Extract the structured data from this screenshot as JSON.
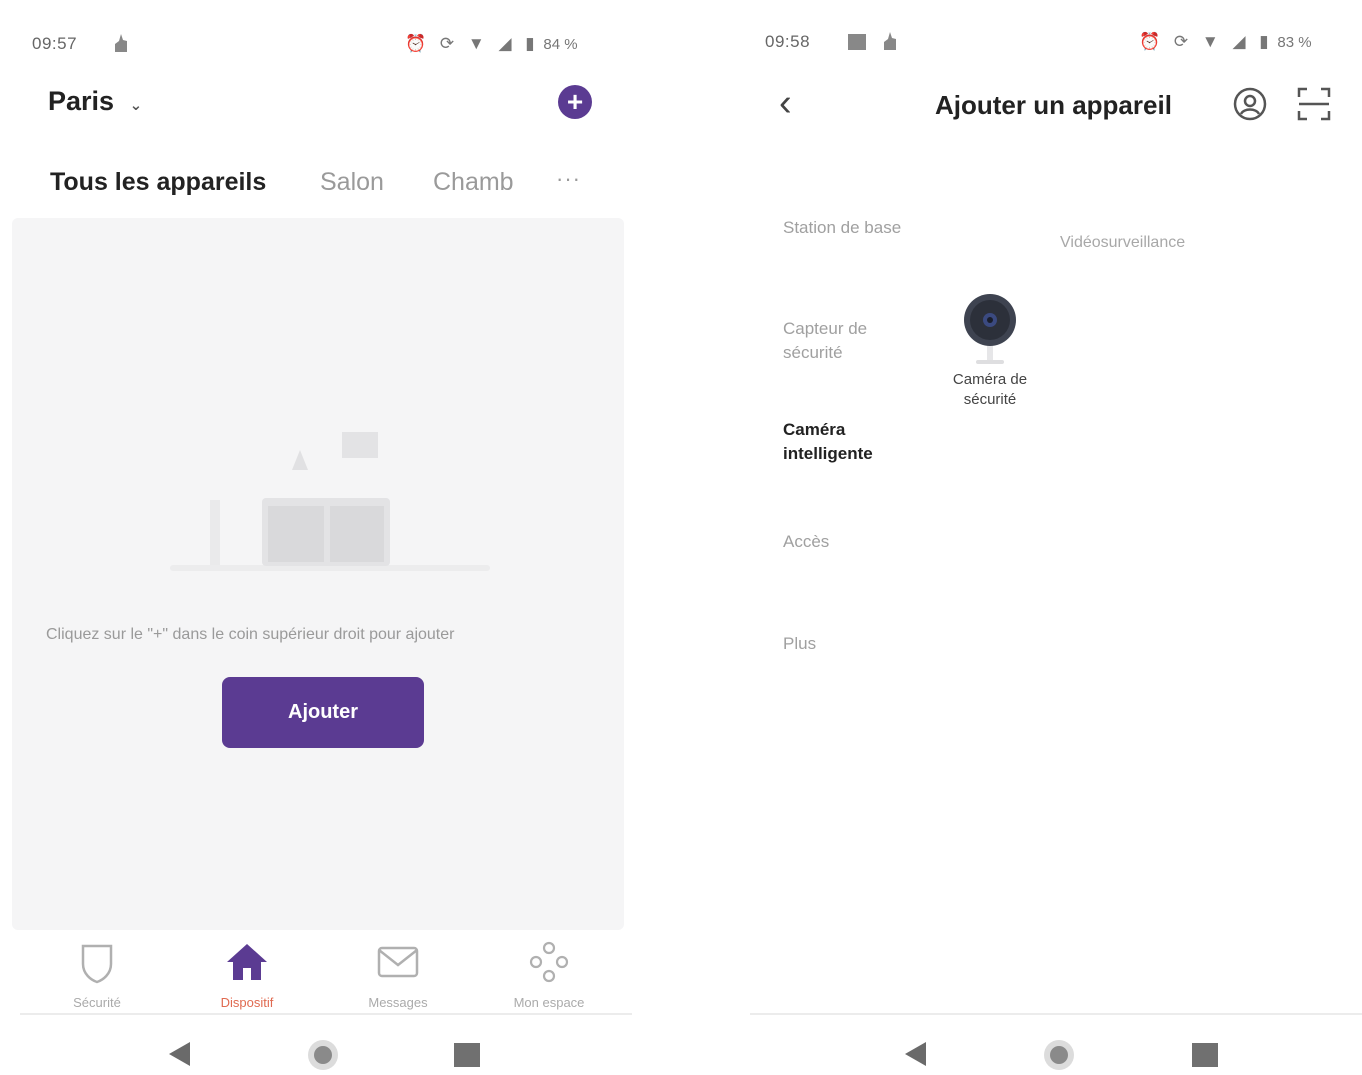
{
  "left": {
    "status": {
      "time": "09:57",
      "battery": "84 %"
    },
    "header": {
      "location": "Paris"
    },
    "tabs": [
      {
        "label": "Tous les appareils"
      },
      {
        "label": "Salon"
      },
      {
        "label": "Chamb"
      }
    ],
    "tabs_more": "···",
    "empty_message": "Cliquez sur le \"+\" dans le coin supérieur droit pour ajouter",
    "add_button": "Ajouter",
    "bottom_nav": [
      {
        "label": "Sécurité",
        "icon": "shield-icon"
      },
      {
        "label": "Dispositif",
        "icon": "home-icon",
        "active": true
      },
      {
        "label": "Messages",
        "icon": "envelope-icon"
      },
      {
        "label": "Mon espace",
        "icon": "profile-icon"
      }
    ],
    "accent_color": "#5b3b92",
    "active_nav_color": "#e06a50"
  },
  "right": {
    "status": {
      "time": "09:58",
      "battery": "83 %"
    },
    "title": "Ajouter un appareil",
    "categories": [
      {
        "label": "Station de base"
      },
      {
        "label": "Capteur de sécurité"
      },
      {
        "label": "Caméra intelligente",
        "active": true
      },
      {
        "label": "Accès"
      },
      {
        "label": "Plus"
      }
    ],
    "section_title": "Vidéosurveillance",
    "devices": [
      {
        "label": "Caméra de sécurité",
        "icon": "camera-icon"
      }
    ]
  }
}
